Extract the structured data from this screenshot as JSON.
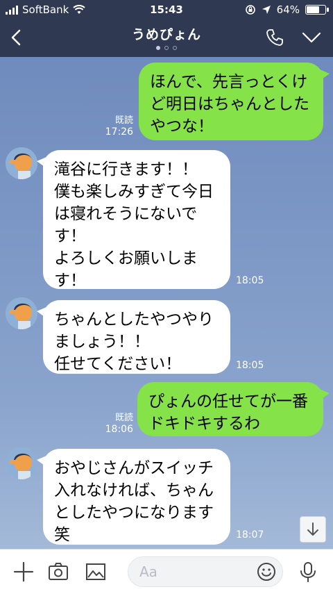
{
  "status": {
    "carrier": "SoftBank",
    "time": "15:43",
    "battery": "64%",
    "battery_level": 0.64
  },
  "header": {
    "title": "うめぴょん"
  },
  "messages": [
    {
      "side": "right",
      "lines": [
        "ほんで、先言っとくけ",
        "ど明日はちゃんとした",
        "やつな！"
      ],
      "read": "既読",
      "time": "17:26"
    },
    {
      "side": "left",
      "lines": [
        "滝谷に行きます！！",
        "僕も楽しみすぎて今日",
        "は寝れそうにないで",
        "す！",
        "よろしくお願いしま",
        "す！"
      ],
      "time": "18:05"
    },
    {
      "side": "left",
      "lines": [
        "ちゃんとしたやつやり",
        "ましょう！！",
        "任せてください！"
      ],
      "time": "18:05"
    },
    {
      "side": "right",
      "lines": [
        "ぴょんの任せてが一番",
        "ドキドキするわ"
      ],
      "read": "既読",
      "time": "18:06"
    },
    {
      "side": "left",
      "lines": [
        "おやじさんがスイッチ",
        "入れなければ、ちゃん",
        "としたやつになります",
        "笑"
      ],
      "time": "18:07"
    }
  ],
  "input": {
    "placeholder": "Aa"
  }
}
